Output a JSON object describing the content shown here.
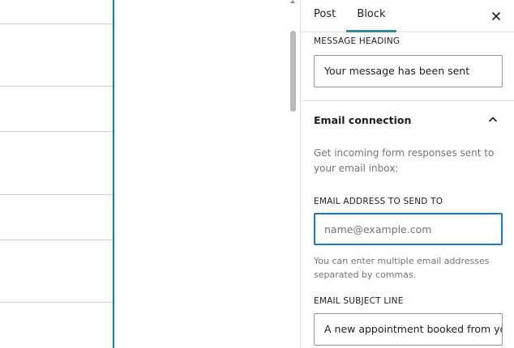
{
  "sidebar": {
    "tabs": [
      {
        "label": "Post"
      },
      {
        "label": "Block"
      }
    ],
    "message_heading": {
      "label": "MESSAGE HEADING",
      "value": "Your message has been sent"
    },
    "email_connection": {
      "title": "Email connection",
      "description": "Get incoming form responses sent to your email inbox:",
      "email_address": {
        "label": "EMAIL ADDRESS TO SEND TO",
        "value": "",
        "placeholder": "name@example.com",
        "help": "You can enter multiple email addresses separated by commas."
      },
      "subject": {
        "label": "EMAIL SUBJECT LINE",
        "value": "A new appointment booked from your website"
      }
    }
  },
  "icons": {
    "close": "close-icon",
    "collapse": "chevron-up-icon"
  },
  "colors": {
    "accent": "#1b79c0",
    "tab_indicator": "#2f8c93"
  }
}
